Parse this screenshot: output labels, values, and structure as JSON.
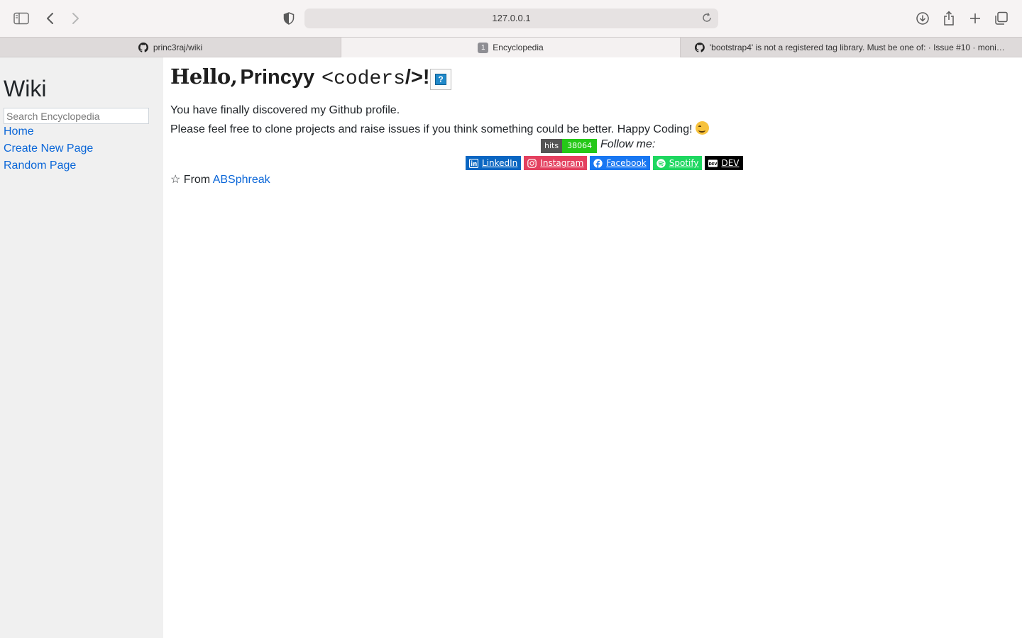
{
  "browser": {
    "url": "127.0.0.1",
    "tabs": [
      {
        "label": "princ3raj/wiki",
        "icon": "github-icon",
        "active": false
      },
      {
        "label": "Encyclopedia",
        "badge": "1",
        "active": true
      },
      {
        "label": "'bootstrap4' is not a registered tag library. Must be one of: · Issue #10 · monim...",
        "icon": "github-icon",
        "active": false
      }
    ]
  },
  "sidebar": {
    "title": "Wiki",
    "search_placeholder": "Search Encyclopedia",
    "links": [
      "Home",
      "Create New Page",
      "Random Page"
    ]
  },
  "main": {
    "greeting_part1": "Hello,",
    "greeting_part2": "Princyy",
    "greeting_lt": "<",
    "greeting_mono": "coders",
    "greeting_end": "/>!",
    "question_mark": "?",
    "line1": "You have finally discovered my Github profile.",
    "line2": "Please feel free to clone projects and raise issues if you think something could be better. Happy Coding!",
    "hits_label": "hits",
    "hits_value": "38064",
    "follow_text": "Follow me:",
    "badges": [
      {
        "label": "LinkedIn",
        "color": "#0a66c2",
        "icon": "linkedin-icon"
      },
      {
        "label": "Instagram",
        "color": "#e4405f",
        "icon": "instagram-icon"
      },
      {
        "label": "Facebook",
        "color": "#1877f2",
        "icon": "facebook-icon"
      },
      {
        "label": "Spotify",
        "color": "#1ed760",
        "icon": "spotify-icon"
      },
      {
        "label": "DEV",
        "color": "#000000",
        "icon": "dev-icon"
      }
    ],
    "from_prefix": "☆ From",
    "from_link": "ABSphreak"
  },
  "colors": {
    "link": "#0a66d8",
    "sidebar_bg": "#f0f0f0",
    "hits_green": "#25c818"
  }
}
